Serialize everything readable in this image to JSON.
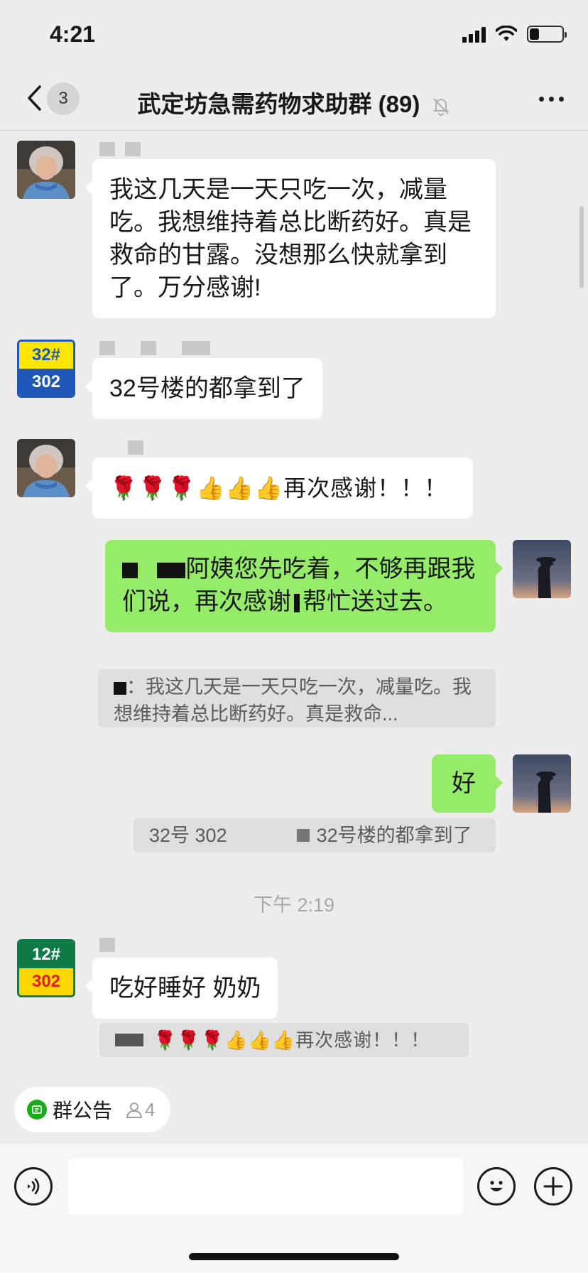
{
  "status": {
    "time": "4:21"
  },
  "nav": {
    "back_badge": "3",
    "title": "武定坊急需药物求助群 (89)"
  },
  "messages": [
    {
      "side": "left",
      "text": "我这几天是一天只吃一次，减量吃。我想维持着总比断药好。真是救命的甘露。没想那么快就拿到了。万分感谢!"
    },
    {
      "side": "left",
      "avatar_text_top": "32#",
      "avatar_text_bottom": "302",
      "text": "32号楼的都拿到了"
    },
    {
      "side": "left",
      "text": "🌹🌹🌹👍👍👍再次感谢！！！"
    },
    {
      "side": "right",
      "text_a": "阿姨您先吃着，不够再跟我们说，再次感谢",
      "text_b": "帮忙送过去。",
      "quote": "：我这几天是一天只吃一次，减量吃。我想维持着总比断药好。真是救命..."
    },
    {
      "side": "right",
      "text": "好",
      "quote_a": "32号 302",
      "quote_b": "32号楼的都拿到了"
    },
    {
      "side": "left",
      "avatar_text_top": "12#",
      "avatar_text_bottom": "302",
      "text": "吃好睡好 奶奶",
      "quote": "🌹🌹🌹👍👍👍再次感谢！！！"
    }
  ],
  "timestamp": "下午 2:19",
  "notice": {
    "label": "群公告",
    "count": "4"
  },
  "input": {
    "placeholder": ""
  },
  "colors": {
    "bg": "#ededed",
    "my_bubble": "#95ec69",
    "their_bubble": "#ffffff",
    "accent": "#1aad19"
  }
}
